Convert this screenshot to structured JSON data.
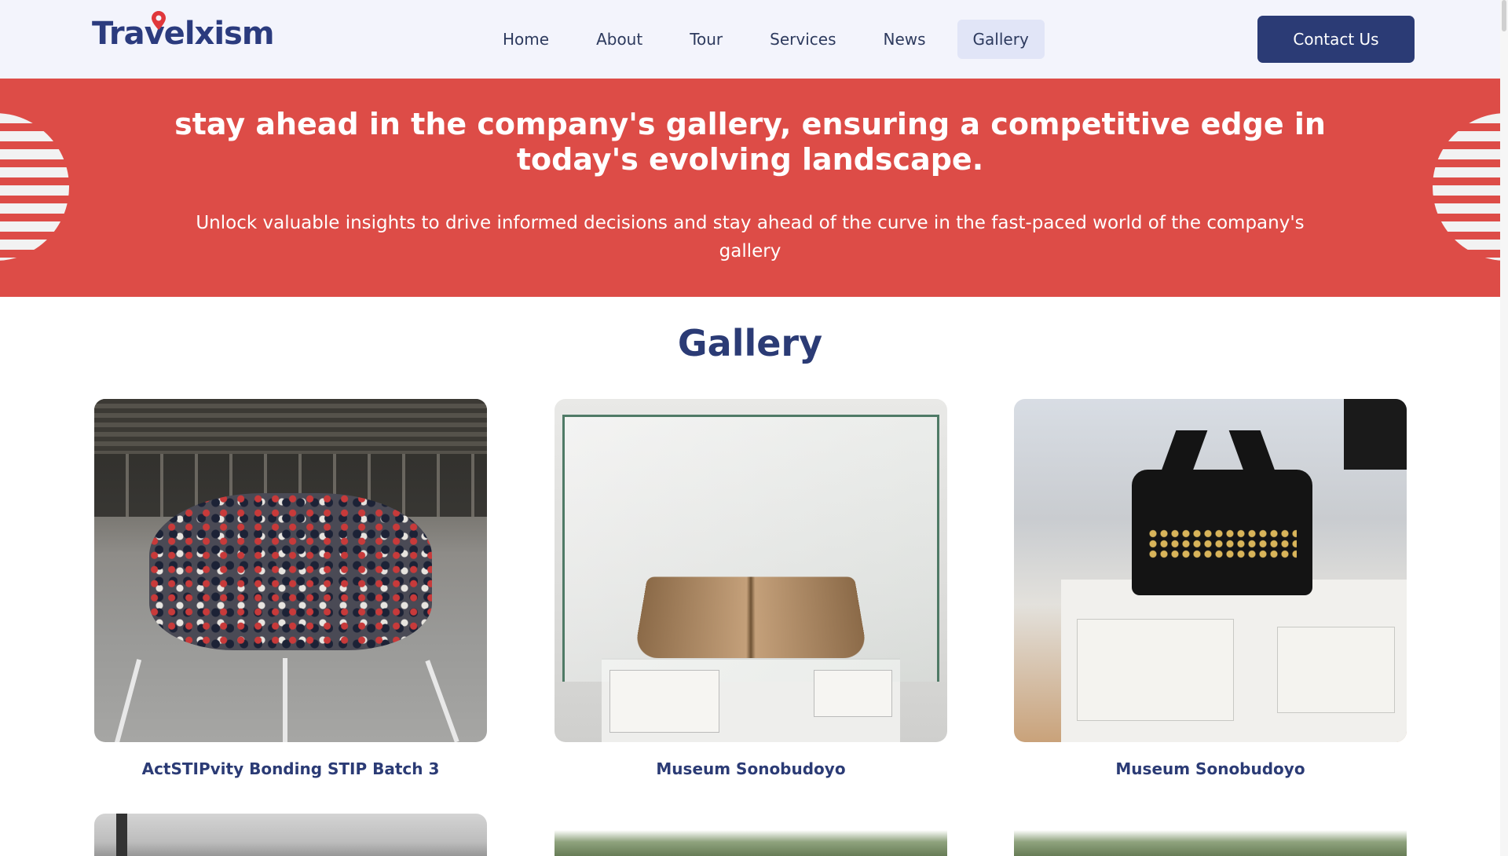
{
  "header": {
    "logo_text": "Travelxism",
    "nav": [
      {
        "label": "Home",
        "active": false
      },
      {
        "label": "About",
        "active": false
      },
      {
        "label": "Tour",
        "active": false
      },
      {
        "label": "Services",
        "active": false
      },
      {
        "label": "News",
        "active": false
      },
      {
        "label": "Gallery",
        "active": true
      }
    ],
    "contact_label": "Contact Us"
  },
  "hero": {
    "title": "stay ahead in the company's gallery, ensuring a competitive edge in today's evolving landscape.",
    "subtitle": "Unlock valuable insights to drive informed decisions and stay ahead of the curve in the fast-paced world of the company's gallery"
  },
  "gallery": {
    "title": "Gallery",
    "items": [
      {
        "caption": "ActSTIPvity Bonding STIP Batch 3",
        "image": "group-photo"
      },
      {
        "caption": "Museum Sonobudoyo",
        "image": "ancient-book-display"
      },
      {
        "caption": "Museum Sonobudoyo",
        "image": "typewriter-display"
      }
    ],
    "row2_images": [
      "outdoor-photo",
      "karst-hill-photo",
      "karst-hill-photo"
    ]
  },
  "colors": {
    "brand_navy": "#2b3b75",
    "hero_red": "#dd4c47",
    "header_bg": "#f3f4fc",
    "logo_pin": "#e0373b"
  }
}
